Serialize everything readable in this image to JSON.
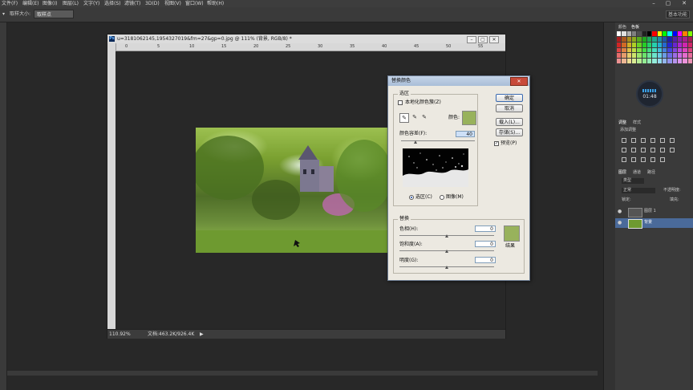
{
  "menubar": {
    "items": [
      "文件(F)",
      "编辑(E)",
      "图像(I)",
      "图层(L)",
      "文字(Y)",
      "选择(S)",
      "滤镜(T)",
      "3D(D)",
      "视图(V)",
      "窗口(W)",
      "帮助(H)"
    ],
    "minimize": "–",
    "restore": "▢",
    "close": "✕"
  },
  "options": {
    "tool_icon": "▾",
    "sample_size_label": "取样大小:",
    "sample_size_value": "取样点",
    "workspace": "基本功能"
  },
  "document": {
    "title": "u=3181062145,1954327019&fm=27&gp=0.jpg @ 111% (背景, RGB/8) *",
    "ps_badge": "Ps",
    "ruler_ticks": [
      "0",
      "5",
      "10",
      "15",
      "20",
      "25",
      "30",
      "35",
      "40",
      "45",
      "50",
      "55"
    ],
    "zoom": "110.92%",
    "doc_info": "文档:463.2K/926.4K",
    "status_arrow": "▶"
  },
  "dialog": {
    "title": "替换颜色",
    "close_label": "✕",
    "selection_group": "选区",
    "localized_label": "本地化颜色簇(Z)",
    "color_label": "颜色:",
    "color_swatch": "#98b25c",
    "fuzziness_label": "颜色容差(F):",
    "fuzziness_value": "40",
    "fuzziness_fraction": 0.2,
    "radio_selection": "选区(C)",
    "radio_image": "图像(M)",
    "ok": "确定",
    "cancel": "取消",
    "load": "载入(L)...",
    "save": "存储(S)...",
    "preview_label": "预览(P)",
    "preview_checked": "✓",
    "replacement_group": "替换",
    "hue_label": "色相(H):",
    "hue_value": "0",
    "sat_label": "饱和度(A):",
    "sat_value": "0",
    "light_label": "明度(G):",
    "light_value": "0",
    "result_label": "结果",
    "result_swatch": "#98b25c"
  },
  "clock": {
    "time": "01:48"
  },
  "panels": {
    "color_tab": "颜色",
    "swatches_tab": "色板",
    "adjust_tab": "调整",
    "styles_tab": "样式",
    "adjust_hint": "添加调整",
    "layers_tab": "图层",
    "channels_tab": "通道",
    "paths_tab": "路径",
    "kind_label": "类型",
    "blend_mode": "正常",
    "opacity_label": "不透明度:",
    "lock_label": "锁定:",
    "fill_label": "填充:",
    "layer1_name": "图层 1",
    "bg_layer_name": "背景",
    "eye_icon": "●"
  }
}
